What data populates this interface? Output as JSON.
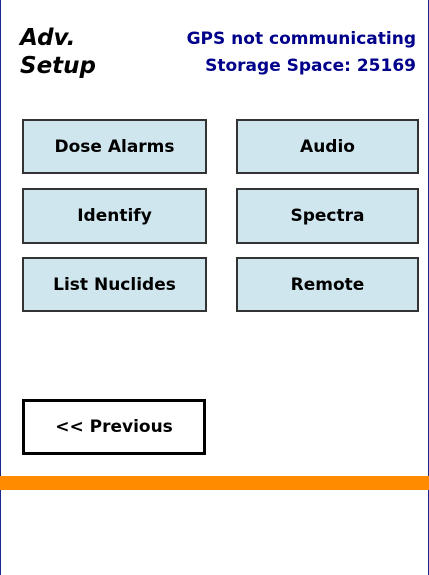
{
  "header": {
    "title_line1": "Adv.",
    "title_line2": "Setup",
    "gps_status": "GPS not communicating",
    "storage_space": "Storage Space: 25169"
  },
  "menu": {
    "dose_alarms": "Dose Alarms",
    "audio": "Audio",
    "identify": "Identify",
    "spectra": "Spectra",
    "list_nuclides": "List Nuclides",
    "remote": "Remote"
  },
  "nav": {
    "previous": "<< Previous"
  },
  "colors": {
    "button_bg": "#cfe6ee",
    "status_text": "#00008b",
    "accent_bar": "#ff8c00"
  }
}
